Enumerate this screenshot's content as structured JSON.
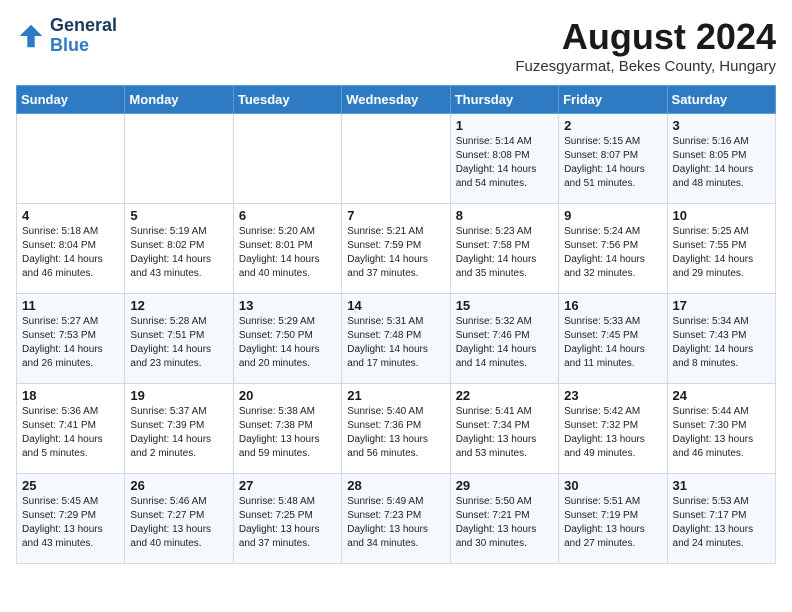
{
  "header": {
    "logo_line1": "General",
    "logo_line2": "Blue",
    "main_title": "August 2024",
    "subtitle": "Fuzesgyarmat, Bekes County, Hungary"
  },
  "days_of_week": [
    "Sunday",
    "Monday",
    "Tuesday",
    "Wednesday",
    "Thursday",
    "Friday",
    "Saturday"
  ],
  "weeks": [
    [
      {
        "day": "",
        "info": ""
      },
      {
        "day": "",
        "info": ""
      },
      {
        "day": "",
        "info": ""
      },
      {
        "day": "",
        "info": ""
      },
      {
        "day": "1",
        "info": "Sunrise: 5:14 AM\nSunset: 8:08 PM\nDaylight: 14 hours\nand 54 minutes."
      },
      {
        "day": "2",
        "info": "Sunrise: 5:15 AM\nSunset: 8:07 PM\nDaylight: 14 hours\nand 51 minutes."
      },
      {
        "day": "3",
        "info": "Sunrise: 5:16 AM\nSunset: 8:05 PM\nDaylight: 14 hours\nand 48 minutes."
      }
    ],
    [
      {
        "day": "4",
        "info": "Sunrise: 5:18 AM\nSunset: 8:04 PM\nDaylight: 14 hours\nand 46 minutes."
      },
      {
        "day": "5",
        "info": "Sunrise: 5:19 AM\nSunset: 8:02 PM\nDaylight: 14 hours\nand 43 minutes."
      },
      {
        "day": "6",
        "info": "Sunrise: 5:20 AM\nSunset: 8:01 PM\nDaylight: 14 hours\nand 40 minutes."
      },
      {
        "day": "7",
        "info": "Sunrise: 5:21 AM\nSunset: 7:59 PM\nDaylight: 14 hours\nand 37 minutes."
      },
      {
        "day": "8",
        "info": "Sunrise: 5:23 AM\nSunset: 7:58 PM\nDaylight: 14 hours\nand 35 minutes."
      },
      {
        "day": "9",
        "info": "Sunrise: 5:24 AM\nSunset: 7:56 PM\nDaylight: 14 hours\nand 32 minutes."
      },
      {
        "day": "10",
        "info": "Sunrise: 5:25 AM\nSunset: 7:55 PM\nDaylight: 14 hours\nand 29 minutes."
      }
    ],
    [
      {
        "day": "11",
        "info": "Sunrise: 5:27 AM\nSunset: 7:53 PM\nDaylight: 14 hours\nand 26 minutes."
      },
      {
        "day": "12",
        "info": "Sunrise: 5:28 AM\nSunset: 7:51 PM\nDaylight: 14 hours\nand 23 minutes."
      },
      {
        "day": "13",
        "info": "Sunrise: 5:29 AM\nSunset: 7:50 PM\nDaylight: 14 hours\nand 20 minutes."
      },
      {
        "day": "14",
        "info": "Sunrise: 5:31 AM\nSunset: 7:48 PM\nDaylight: 14 hours\nand 17 minutes."
      },
      {
        "day": "15",
        "info": "Sunrise: 5:32 AM\nSunset: 7:46 PM\nDaylight: 14 hours\nand 14 minutes."
      },
      {
        "day": "16",
        "info": "Sunrise: 5:33 AM\nSunset: 7:45 PM\nDaylight: 14 hours\nand 11 minutes."
      },
      {
        "day": "17",
        "info": "Sunrise: 5:34 AM\nSunset: 7:43 PM\nDaylight: 14 hours\nand 8 minutes."
      }
    ],
    [
      {
        "day": "18",
        "info": "Sunrise: 5:36 AM\nSunset: 7:41 PM\nDaylight: 14 hours\nand 5 minutes."
      },
      {
        "day": "19",
        "info": "Sunrise: 5:37 AM\nSunset: 7:39 PM\nDaylight: 14 hours\nand 2 minutes."
      },
      {
        "day": "20",
        "info": "Sunrise: 5:38 AM\nSunset: 7:38 PM\nDaylight: 13 hours\nand 59 minutes."
      },
      {
        "day": "21",
        "info": "Sunrise: 5:40 AM\nSunset: 7:36 PM\nDaylight: 13 hours\nand 56 minutes."
      },
      {
        "day": "22",
        "info": "Sunrise: 5:41 AM\nSunset: 7:34 PM\nDaylight: 13 hours\nand 53 minutes."
      },
      {
        "day": "23",
        "info": "Sunrise: 5:42 AM\nSunset: 7:32 PM\nDaylight: 13 hours\nand 49 minutes."
      },
      {
        "day": "24",
        "info": "Sunrise: 5:44 AM\nSunset: 7:30 PM\nDaylight: 13 hours\nand 46 minutes."
      }
    ],
    [
      {
        "day": "25",
        "info": "Sunrise: 5:45 AM\nSunset: 7:29 PM\nDaylight: 13 hours\nand 43 minutes."
      },
      {
        "day": "26",
        "info": "Sunrise: 5:46 AM\nSunset: 7:27 PM\nDaylight: 13 hours\nand 40 minutes."
      },
      {
        "day": "27",
        "info": "Sunrise: 5:48 AM\nSunset: 7:25 PM\nDaylight: 13 hours\nand 37 minutes."
      },
      {
        "day": "28",
        "info": "Sunrise: 5:49 AM\nSunset: 7:23 PM\nDaylight: 13 hours\nand 34 minutes."
      },
      {
        "day": "29",
        "info": "Sunrise: 5:50 AM\nSunset: 7:21 PM\nDaylight: 13 hours\nand 30 minutes."
      },
      {
        "day": "30",
        "info": "Sunrise: 5:51 AM\nSunset: 7:19 PM\nDaylight: 13 hours\nand 27 minutes."
      },
      {
        "day": "31",
        "info": "Sunrise: 5:53 AM\nSunset: 7:17 PM\nDaylight: 13 hours\nand 24 minutes."
      }
    ]
  ]
}
